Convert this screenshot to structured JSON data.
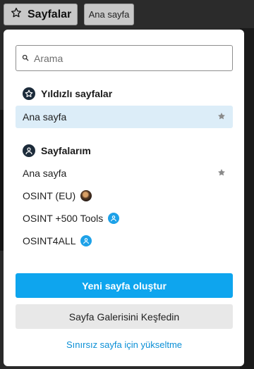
{
  "header": {
    "starred_button_label": "Sayfalar",
    "home_tab_label": "Ana sayfa"
  },
  "dropdown": {
    "search_placeholder": "Arama",
    "starred_section": {
      "title": "Yıldızlı sayfalar",
      "items": [
        {
          "label": "Ana sayfa",
          "starred": true,
          "selected": true
        }
      ]
    },
    "my_pages_section": {
      "title": "Sayfalarım",
      "items": [
        {
          "label": "Ana sayfa",
          "starred": true
        },
        {
          "label": "OSINT (EU)",
          "icon": "avatar-photo"
        },
        {
          "label": "OSINT +500 Tools",
          "icon": "team-icon"
        },
        {
          "label": "OSINT4ALL",
          "icon": "team-icon"
        }
      ]
    },
    "create_button_label": "Yeni sayfa oluştur",
    "gallery_button_label": "Sayfa Galerisini Keşfedin",
    "upgrade_link_label": "Sınırsız sayfa için yükseltme"
  },
  "colors": {
    "primary": "#0ea5ee",
    "selected_row": "#dcedf8",
    "team_badge": "#1da1e8",
    "section_icon": "#1c2b3a"
  }
}
